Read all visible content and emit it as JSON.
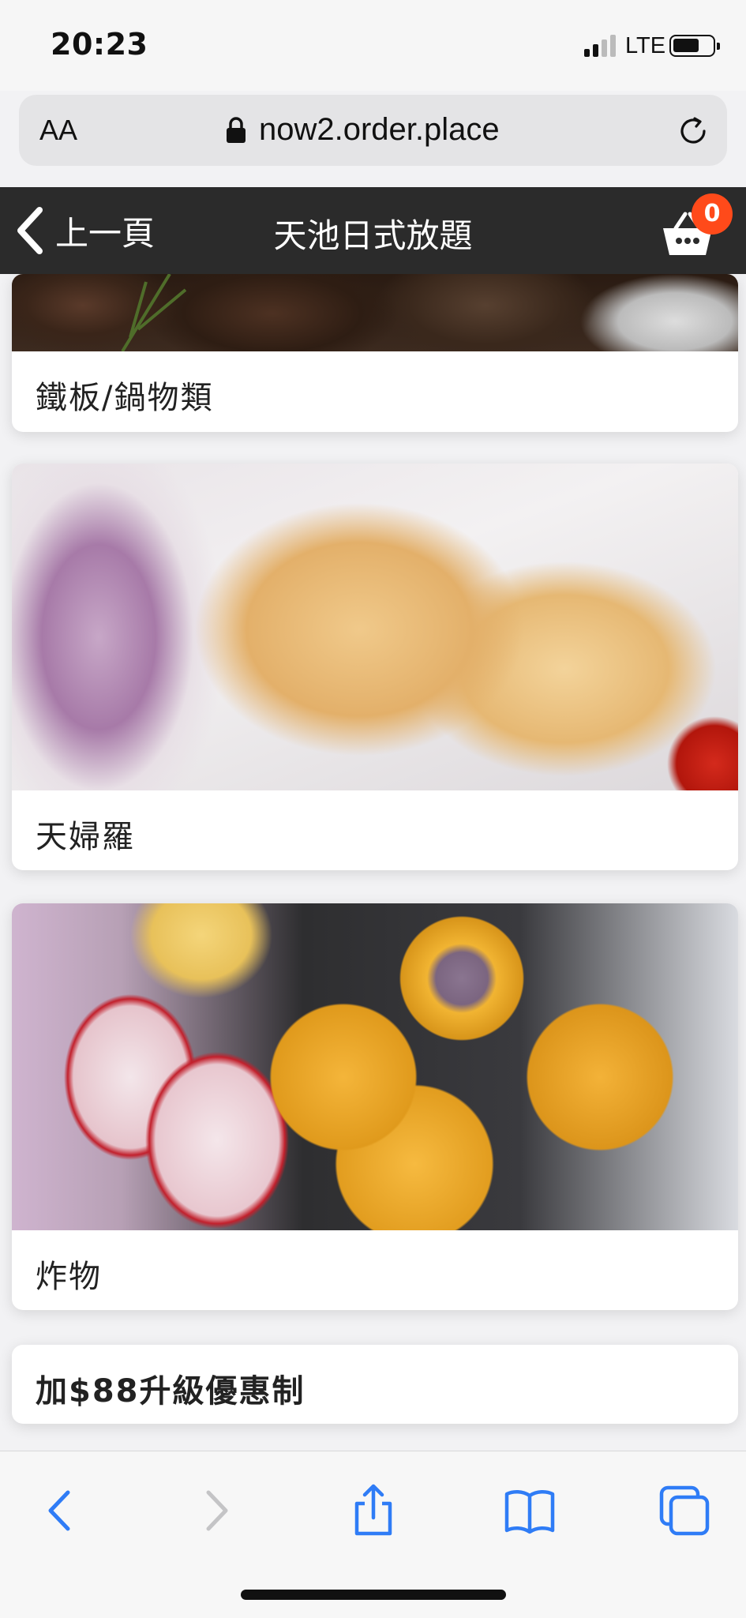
{
  "status_bar": {
    "time": "20:23",
    "network": "LTE"
  },
  "browser": {
    "text_size_button": "AA",
    "url": "now2.order.place"
  },
  "header": {
    "back_label": "上一頁",
    "title": "天池日式放題",
    "cart_count": "0"
  },
  "categories": [
    {
      "label": "鐵板/鍋物類",
      "image": "grilled-beef-photo"
    },
    {
      "label": "天婦羅",
      "image": "tempura-photo"
    },
    {
      "label": "炸物",
      "image": "fried-croquettes-photo"
    },
    {
      "label": "加$88升級優惠制"
    }
  ],
  "toolbar": {
    "icons": [
      "back-arrow-icon",
      "forward-arrow-icon",
      "share-icon",
      "bookmarks-icon",
      "tabs-icon"
    ]
  },
  "colors": {
    "header_bg": "#2b2b2b",
    "badge": "#ff4a1a",
    "safari_blue": "#2f7cf6"
  }
}
